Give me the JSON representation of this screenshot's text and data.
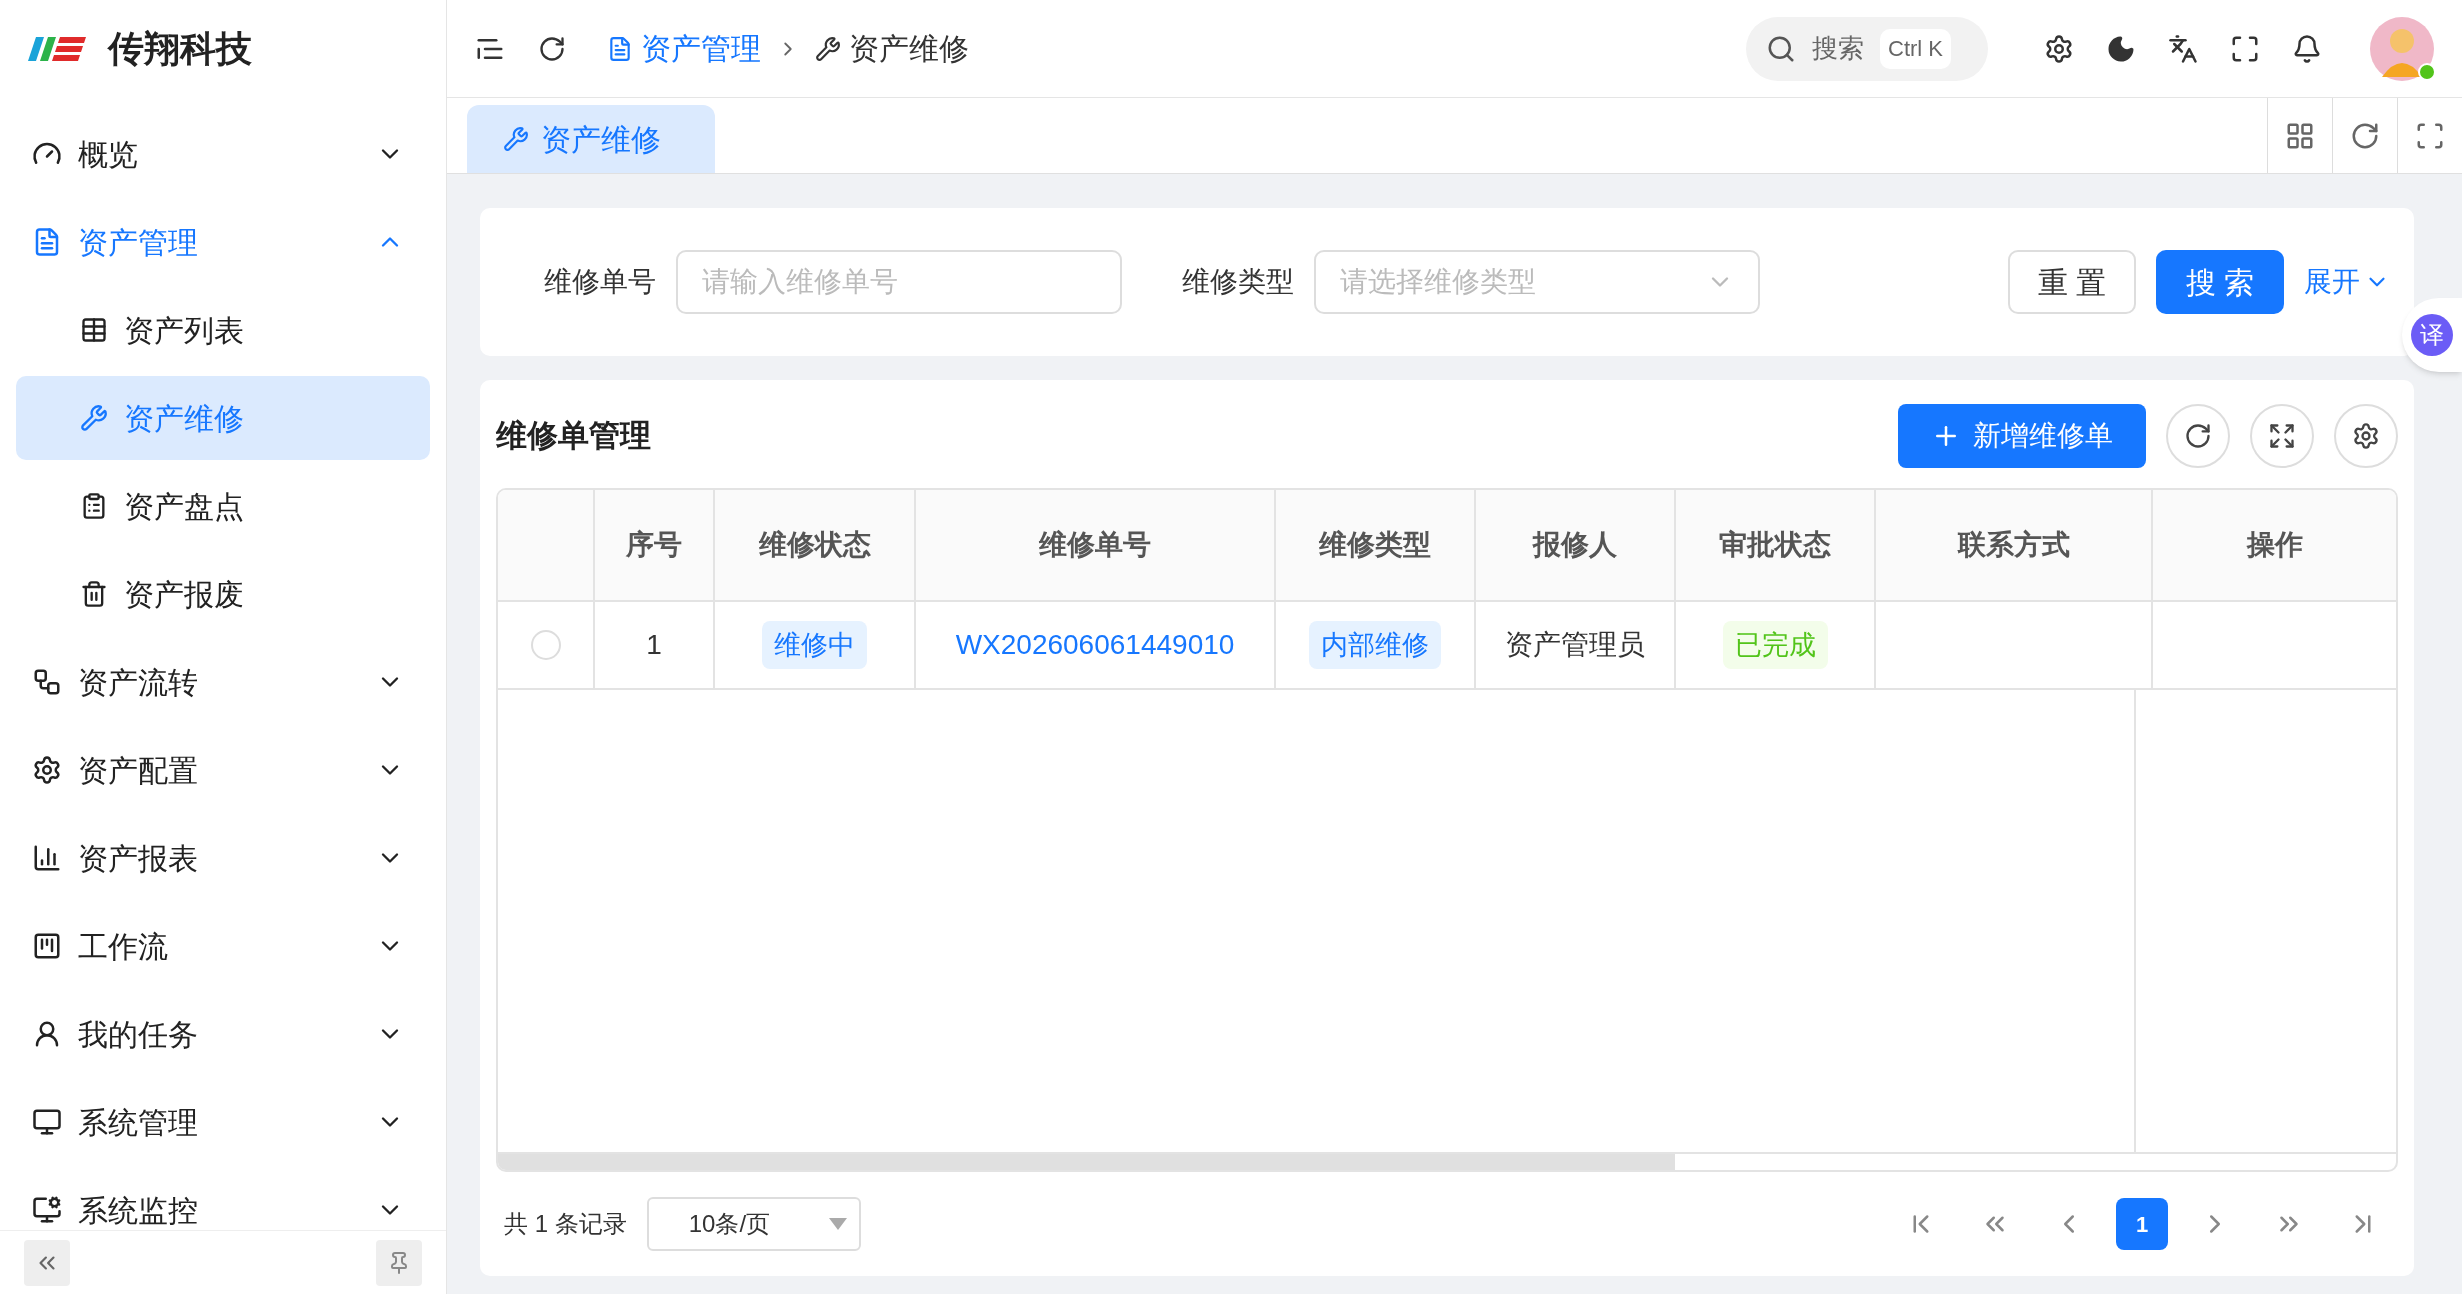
{
  "brand": {
    "name": "传翔科技"
  },
  "sidebar": {
    "items": [
      {
        "label": "概览",
        "expanded": false,
        "selected": false
      },
      {
        "label": "资产管理",
        "expanded": true,
        "selected": true,
        "children": [
          {
            "label": "资产列表",
            "selected": false
          },
          {
            "label": "资产维修",
            "selected": true
          },
          {
            "label": "资产盘点",
            "selected": false
          },
          {
            "label": "资产报废",
            "selected": false
          }
        ]
      },
      {
        "label": "资产流转",
        "expanded": false,
        "selected": false
      },
      {
        "label": "资产配置",
        "expanded": false,
        "selected": false
      },
      {
        "label": "资产报表",
        "expanded": false,
        "selected": false
      },
      {
        "label": "工作流",
        "expanded": false,
        "selected": false
      },
      {
        "label": "我的任务",
        "expanded": false,
        "selected": false
      },
      {
        "label": "系统管理",
        "expanded": false,
        "selected": false
      },
      {
        "label": "系统监控",
        "expanded": false,
        "selected": false
      }
    ]
  },
  "breadcrumb": [
    {
      "label": "资产管理"
    },
    {
      "label": "资产维修"
    }
  ],
  "header": {
    "search_placeholder": "搜索",
    "shortcut": "Ctrl K",
    "user_online": true
  },
  "tabs": [
    {
      "label": "资产维修",
      "selected": true
    }
  ],
  "filters": [
    {
      "label": "维修单号",
      "placeholder": "请输入维修单号",
      "kind": "input"
    },
    {
      "label": "维修类型",
      "placeholder": "请选择维修类型",
      "kind": "select"
    }
  ],
  "filter_buttons": {
    "reset": "重 置",
    "search": "搜 索",
    "expand": "展开"
  },
  "translate_badge": "译",
  "table": {
    "title": "维修单管理",
    "add_button": "新增维修单",
    "columns": [
      "序号",
      "维修状态",
      "维修单号",
      "维修类型",
      "报修人",
      "审批状态",
      "联系方式",
      "操作"
    ],
    "rows": [
      {
        "selected": false,
        "cells": [
          {
            "text": "1",
            "kind": "text"
          },
          {
            "text": "维修中",
            "kind": "tag"
          },
          {
            "text": "WX202606061449010",
            "kind": "link"
          },
          {
            "text": "内部维修",
            "kind": "tag"
          },
          {
            "text": "资产管理员",
            "kind": "text"
          },
          {
            "text": "已完成",
            "kind": "success"
          }
        ]
      }
    ]
  },
  "pagination": {
    "total": "共 1 条记录",
    "page_size": "10条/页",
    "pages": [
      {
        "label": "1",
        "selected": true
      }
    ]
  }
}
